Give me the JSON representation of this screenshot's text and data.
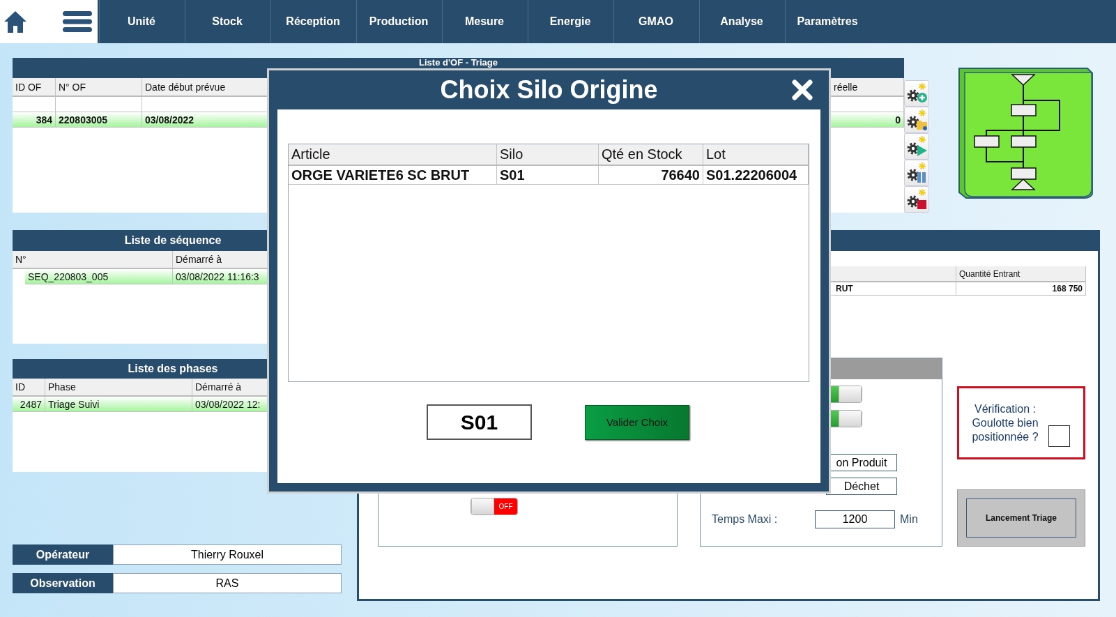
{
  "nav": {
    "tabs": [
      {
        "label": "Unité"
      },
      {
        "label": "Stock"
      },
      {
        "label": "Réception"
      },
      {
        "label": "Production"
      },
      {
        "label": "Mesure"
      },
      {
        "label": "Energie"
      },
      {
        "label": "GMAO"
      },
      {
        "label": "Analyse"
      },
      {
        "label": "Paramètres"
      }
    ]
  },
  "of_list": {
    "title": "Liste d'OF - Triage",
    "columns": [
      "ID OF",
      "N° OF",
      "Date début prévue",
      "réelle"
    ],
    "rows": [
      {
        "cells": [
          "384",
          "220803005",
          "03/08/2022",
          "0"
        ],
        "selected": true
      }
    ]
  },
  "sequences": {
    "title": "Liste de séquence",
    "columns": [
      "N°",
      "Démarré à"
    ],
    "rows": [
      {
        "cells": [
          "SEQ_220803_005",
          "03/08/2022 11:16:3"
        ],
        "selected": true
      }
    ]
  },
  "phases": {
    "title": "Liste des phases",
    "columns": [
      "ID",
      "Phase",
      "Démarré à"
    ],
    "rows": [
      {
        "cells": [
          "2487",
          "Triage Suivi",
          "03/08/2022 12:"
        ],
        "selected": true
      }
    ]
  },
  "operator": [
    {
      "label": "Opérateur",
      "value": "Thierry Rouxel"
    },
    {
      "label": "Observation",
      "value": "RAS"
    }
  ],
  "triage_panel": {
    "columns": [
      "Quantité Entrant"
    ],
    "rows": [
      {
        "cells": [
          "RUT",
          "168 750"
        ]
      }
    ]
  },
  "container_toggle": {
    "on": false,
    "text": "OFF"
  },
  "settings": {
    "toggles": [
      {
        "on": true
      },
      {
        "on": true
      }
    ],
    "fields": [
      "on Produit",
      "Déchet"
    ],
    "max_time": {
      "label": "Temps Maxi :",
      "value": "1200",
      "unit": "Min"
    }
  },
  "verification": {
    "label": "Vérification : Goulotte bien positionnée ?",
    "checked": false
  },
  "launch_button": "Lancement Triage",
  "modal": {
    "title": "Choix Silo Origine",
    "columns": [
      "Article",
      "Silo",
      "Qté en Stock",
      "Lot"
    ],
    "rows": [
      {
        "cells": [
          "ORGE VARIETE6 SC BRUT",
          "S01",
          "76640",
          "S01.22206004"
        ]
      }
    ],
    "choice": "S01",
    "confirm": "Valider Choix"
  }
}
